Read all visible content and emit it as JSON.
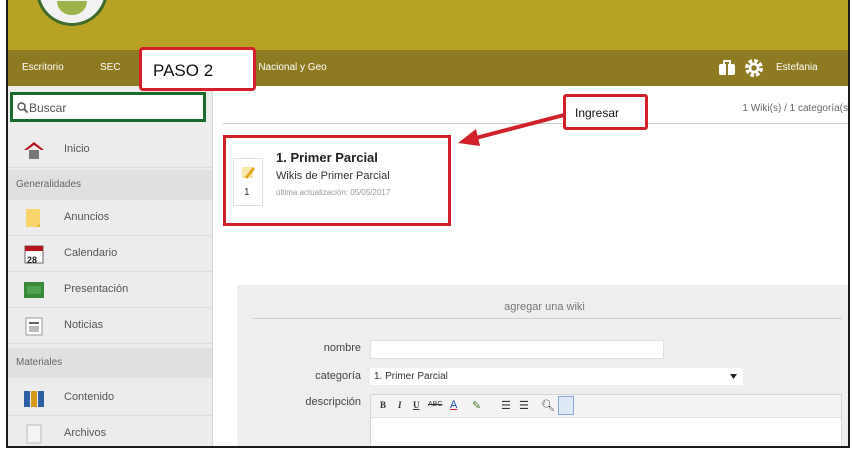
{
  "nav": {
    "escritorio": "Escritorio",
    "course_prefix": "SEC",
    "course_suffix": "d Nacional y Geo",
    "user_name": "Estefania"
  },
  "sidebar": {
    "search_placeholder": "Buscar",
    "inicio": "Inicio",
    "group_generalidades": "Generalidades",
    "items_general": [
      "Anuncios",
      "Calendario",
      "Presentación",
      "Noticias"
    ],
    "calendar_day": "28",
    "group_materiales": "Materiales",
    "items_materiales": [
      "Contenido",
      "Archivos"
    ]
  },
  "main": {
    "wiki_count": "1 Wiki(s) / 1 categoría(s",
    "wiki": {
      "title": "1. Primer Parcial",
      "subtitle": "Wikis de Primer Parcial",
      "updated": "última actualización: 05/05/2017",
      "count": "1"
    },
    "form": {
      "title": "agregar una wiki",
      "nombre_label": "nombre",
      "categoria_label": "categoría",
      "categoria_value": "1. Primer Parcial",
      "descripcion_label": "descripción"
    }
  },
  "annotations": {
    "paso": "PASO 2",
    "ingresar": "Ingresar"
  },
  "colors": {
    "topbar": "#b7a224",
    "navbar": "#8e7a21",
    "highlight": "#d1202a",
    "search_border": "#1a6b2c"
  }
}
